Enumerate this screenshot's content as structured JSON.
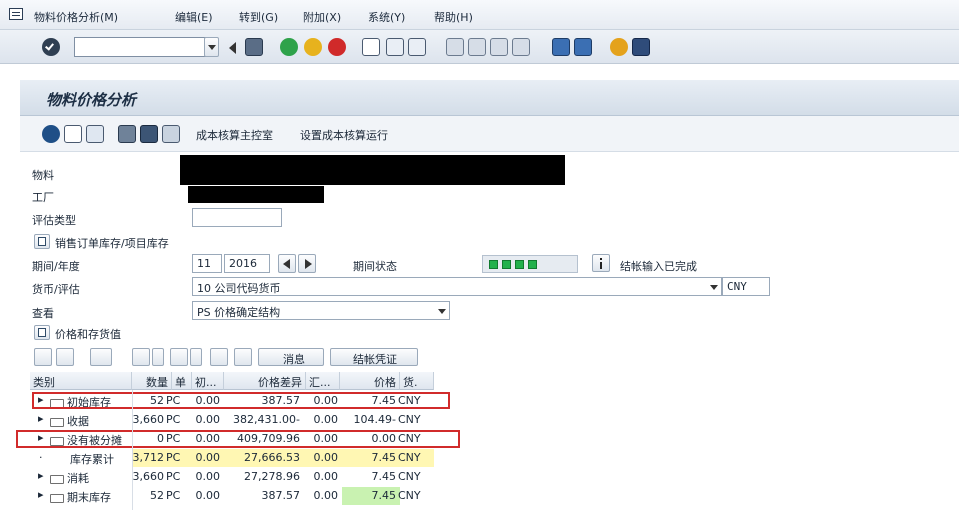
{
  "menu": [
    "物料价格分析(M)",
    "编辑(E)",
    "转到(G)",
    "附加(X)",
    "系统(Y)",
    "帮助(H)"
  ],
  "title": "物料价格分析",
  "app_toolbar": {
    "link1": "成本核算主控室",
    "link2": "设置成本核算运行"
  },
  "fields": {
    "material_label": "物料",
    "plant_label": "工厂",
    "valuation_type_label": "评估类型",
    "sales_order_label": "销售订单库存/项目库存",
    "period_year_label": "期间/年度",
    "period_value": "11",
    "year_value": "2016",
    "period_status_label": "期间状态",
    "closing_text": "结帐输入已完成",
    "currency_valuation_label": "货币/评估",
    "currency_value": "10 公司代码货币",
    "currency_code": "CNY",
    "view_label": "查看",
    "view_value": "PS 价格确定结构",
    "price_inventory_label": "价格和存货值"
  },
  "grid_toolbar": {
    "msg_button": "消息",
    "voucher_button": "结帐凭证"
  },
  "grid": {
    "headers": [
      "类别",
      "数量",
      "单",
      "初...",
      "价格差异",
      "汇...",
      "价格",
      "货."
    ],
    "rows": [
      {
        "category": "初始库存",
        "qty": "52",
        "unit": "PC",
        "init": "0.00",
        "price_diff": "387.57",
        "exch": "0.00",
        "price": "7.45",
        "cur": "CNY"
      },
      {
        "category": "收据",
        "qty": "3,660",
        "unit": "PC",
        "init": "0.00",
        "price_diff": "382,431.00-",
        "exch": "0.00",
        "price": "104.49-",
        "cur": "CNY"
      },
      {
        "category": "没有被分摊",
        "qty": "0",
        "unit": "PC",
        "init": "0.00",
        "price_diff": "409,709.96",
        "exch": "0.00",
        "price": "0.00",
        "cur": "CNY"
      },
      {
        "category": "库存累计",
        "qty": "3,712",
        "unit": "PC",
        "init": "0.00",
        "price_diff": "27,666.53",
        "exch": "0.00",
        "price": "7.45",
        "cur": "CNY"
      },
      {
        "category": "消耗",
        "qty": "3,660",
        "unit": "PC",
        "init": "0.00",
        "price_diff": "27,278.96",
        "exch": "0.00",
        "price": "7.45",
        "cur": "CNY"
      },
      {
        "category": "期末库存",
        "qty": "52",
        "unit": "PC",
        "init": "0.00",
        "price_diff": "387.57",
        "exch": "0.00",
        "price": "7.45",
        "cur": "CNY"
      }
    ]
  },
  "colors": {
    "status_green": "#22b14c",
    "highlight_yellow": "#fff7b3",
    "highlight_green": "#c9f2b1",
    "red_box": "#d12b2b"
  }
}
